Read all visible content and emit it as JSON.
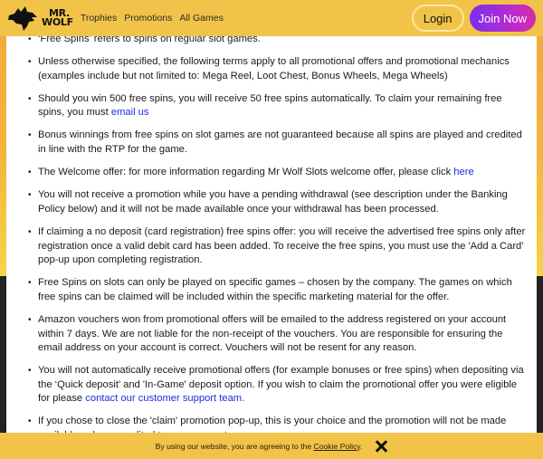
{
  "header": {
    "logo_line1": "MR.",
    "logo_line2": "WOLF",
    "nav": [
      {
        "label": "Trophies"
      },
      {
        "label": "Promotions"
      },
      {
        "label": "All Games"
      }
    ],
    "login_label": "Login",
    "join_label": "Join Now"
  },
  "terms": [
    {
      "text": "‘Free Spins’ refers to spins on regular slot games."
    },
    {
      "text": "Unless otherwise specified, the following terms apply to all promotional offers and promotional mechanics (examples include but not limited to: Mega Reel, Loot Chest, Bonus Wheels, Mega Wheels)"
    },
    {
      "text": "Should you win 500 free spins, you will receive 50 free spins automatically. To claim your remaining free spins, you must ",
      "link": "email us",
      "after": ""
    },
    {
      "text": "Bonus winnings from free spins on slot games are not guaranteed because all spins are played and credited in line with the RTP for the game."
    },
    {
      "text": "The Welcome offer: for more information regarding Mr Wolf Slots welcome offer, please click ",
      "link": "here",
      "after": ""
    },
    {
      "text": "You will not receive a promotion while you have a pending withdrawal (see description under the Banking Policy below) and it will not be made available once your withdrawal has been processed."
    },
    {
      "text": "If claiming a no deposit (card registration) free spins offer: you will receive the advertised free spins only after registration once a valid debit card has been added. To receive the free spins, you must use the 'Add a Card' pop-up upon completing registration."
    },
    {
      "text": "Free Spins on slots can only be played on specific games – chosen by the company. The games on which free spins can be claimed will be included within the specific marketing material for the offer."
    },
    {
      "text": "Amazon vouchers won from promotional offers will be emailed to the address registered on your account within 7 days. We are not liable for the non-receipt of the vouchers. You are responsible for ensuring the email address on your account is correct. Vouchers will not be resent for any reason."
    },
    {
      "text": "You will not automatically receive promotional offers (for example bonuses or free spins) when depositing via the ‘Quick deposit’ and 'In-Game' deposit option. If you wish to claim the promotional offer you were eligible for please ",
      "link": "contact our customer support team.",
      "after": ""
    },
    {
      "text": "If you chose to close the 'claim' promotion pop-up, this is your choice and the promotion will not be made available or be re-credited to your account."
    }
  ],
  "cookie": {
    "text": "By using our website, you are agreeing to the ",
    "link": "Cookie Policy",
    "after": "."
  },
  "colors": {
    "header_bg": "#f1c348",
    "link": "#1f2be0",
    "join_gradient_start": "#7b2ff0",
    "join_gradient_end": "#d62aa8",
    "page_dark": "#232323"
  }
}
